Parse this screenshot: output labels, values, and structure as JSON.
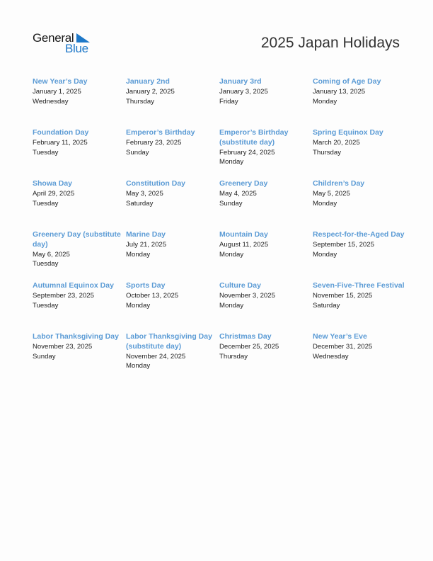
{
  "logo": {
    "text_general": "General",
    "text_blue": "Blue",
    "icon": "triangle-flag-icon",
    "accent_color": "#1e78c8"
  },
  "title": "2025 Japan Holidays",
  "holiday_name_color": "#5b9bd5",
  "holidays": [
    {
      "name": "New Year’s Day",
      "date": "January 1, 2025",
      "weekday": "Wednesday"
    },
    {
      "name": "January 2nd",
      "date": "January 2, 2025",
      "weekday": "Thursday"
    },
    {
      "name": "January 3rd",
      "date": "January 3, 2025",
      "weekday": "Friday"
    },
    {
      "name": "Coming of Age Day",
      "date": "January 13, 2025",
      "weekday": "Monday"
    },
    {
      "name": "Foundation Day",
      "date": "February 11, 2025",
      "weekday": "Tuesday"
    },
    {
      "name": "Emperor’s Birthday",
      "date": "February 23, 2025",
      "weekday": "Sunday"
    },
    {
      "name": "Emperor’s Birthday (substitute day)",
      "date": "February 24, 2025",
      "weekday": "Monday"
    },
    {
      "name": "Spring Equinox Day",
      "date": "March 20, 2025",
      "weekday": "Thursday"
    },
    {
      "name": "Showa Day",
      "date": "April 29, 2025",
      "weekday": "Tuesday"
    },
    {
      "name": "Constitution Day",
      "date": "May 3, 2025",
      "weekday": "Saturday"
    },
    {
      "name": "Greenery Day",
      "date": "May 4, 2025",
      "weekday": "Sunday"
    },
    {
      "name": "Children’s Day",
      "date": "May 5, 2025",
      "weekday": "Monday"
    },
    {
      "name": "Greenery Day (substitute day)",
      "date": "May 6, 2025",
      "weekday": "Tuesday"
    },
    {
      "name": "Marine Day",
      "date": "July 21, 2025",
      "weekday": "Monday"
    },
    {
      "name": "Mountain Day",
      "date": "August 11, 2025",
      "weekday": "Monday"
    },
    {
      "name": "Respect-for-the-Aged Day",
      "date": "September 15, 2025",
      "weekday": "Monday"
    },
    {
      "name": "Autumnal Equinox Day",
      "date": "September 23, 2025",
      "weekday": "Tuesday"
    },
    {
      "name": "Sports Day",
      "date": "October 13, 2025",
      "weekday": "Monday"
    },
    {
      "name": "Culture Day",
      "date": "November 3, 2025",
      "weekday": "Monday"
    },
    {
      "name": "Seven-Five-Three Festival",
      "date": "November 15, 2025",
      "weekday": "Saturday"
    },
    {
      "name": "Labor Thanksgiving Day",
      "date": "November 23, 2025",
      "weekday": "Sunday"
    },
    {
      "name": "Labor Thanksgiving Day (substitute day)",
      "date": "November 24, 2025",
      "weekday": "Monday"
    },
    {
      "name": "Christmas Day",
      "date": "December 25, 2025",
      "weekday": "Thursday"
    },
    {
      "name": "New Year’s Eve",
      "date": "December 31, 2025",
      "weekday": "Wednesday"
    }
  ]
}
